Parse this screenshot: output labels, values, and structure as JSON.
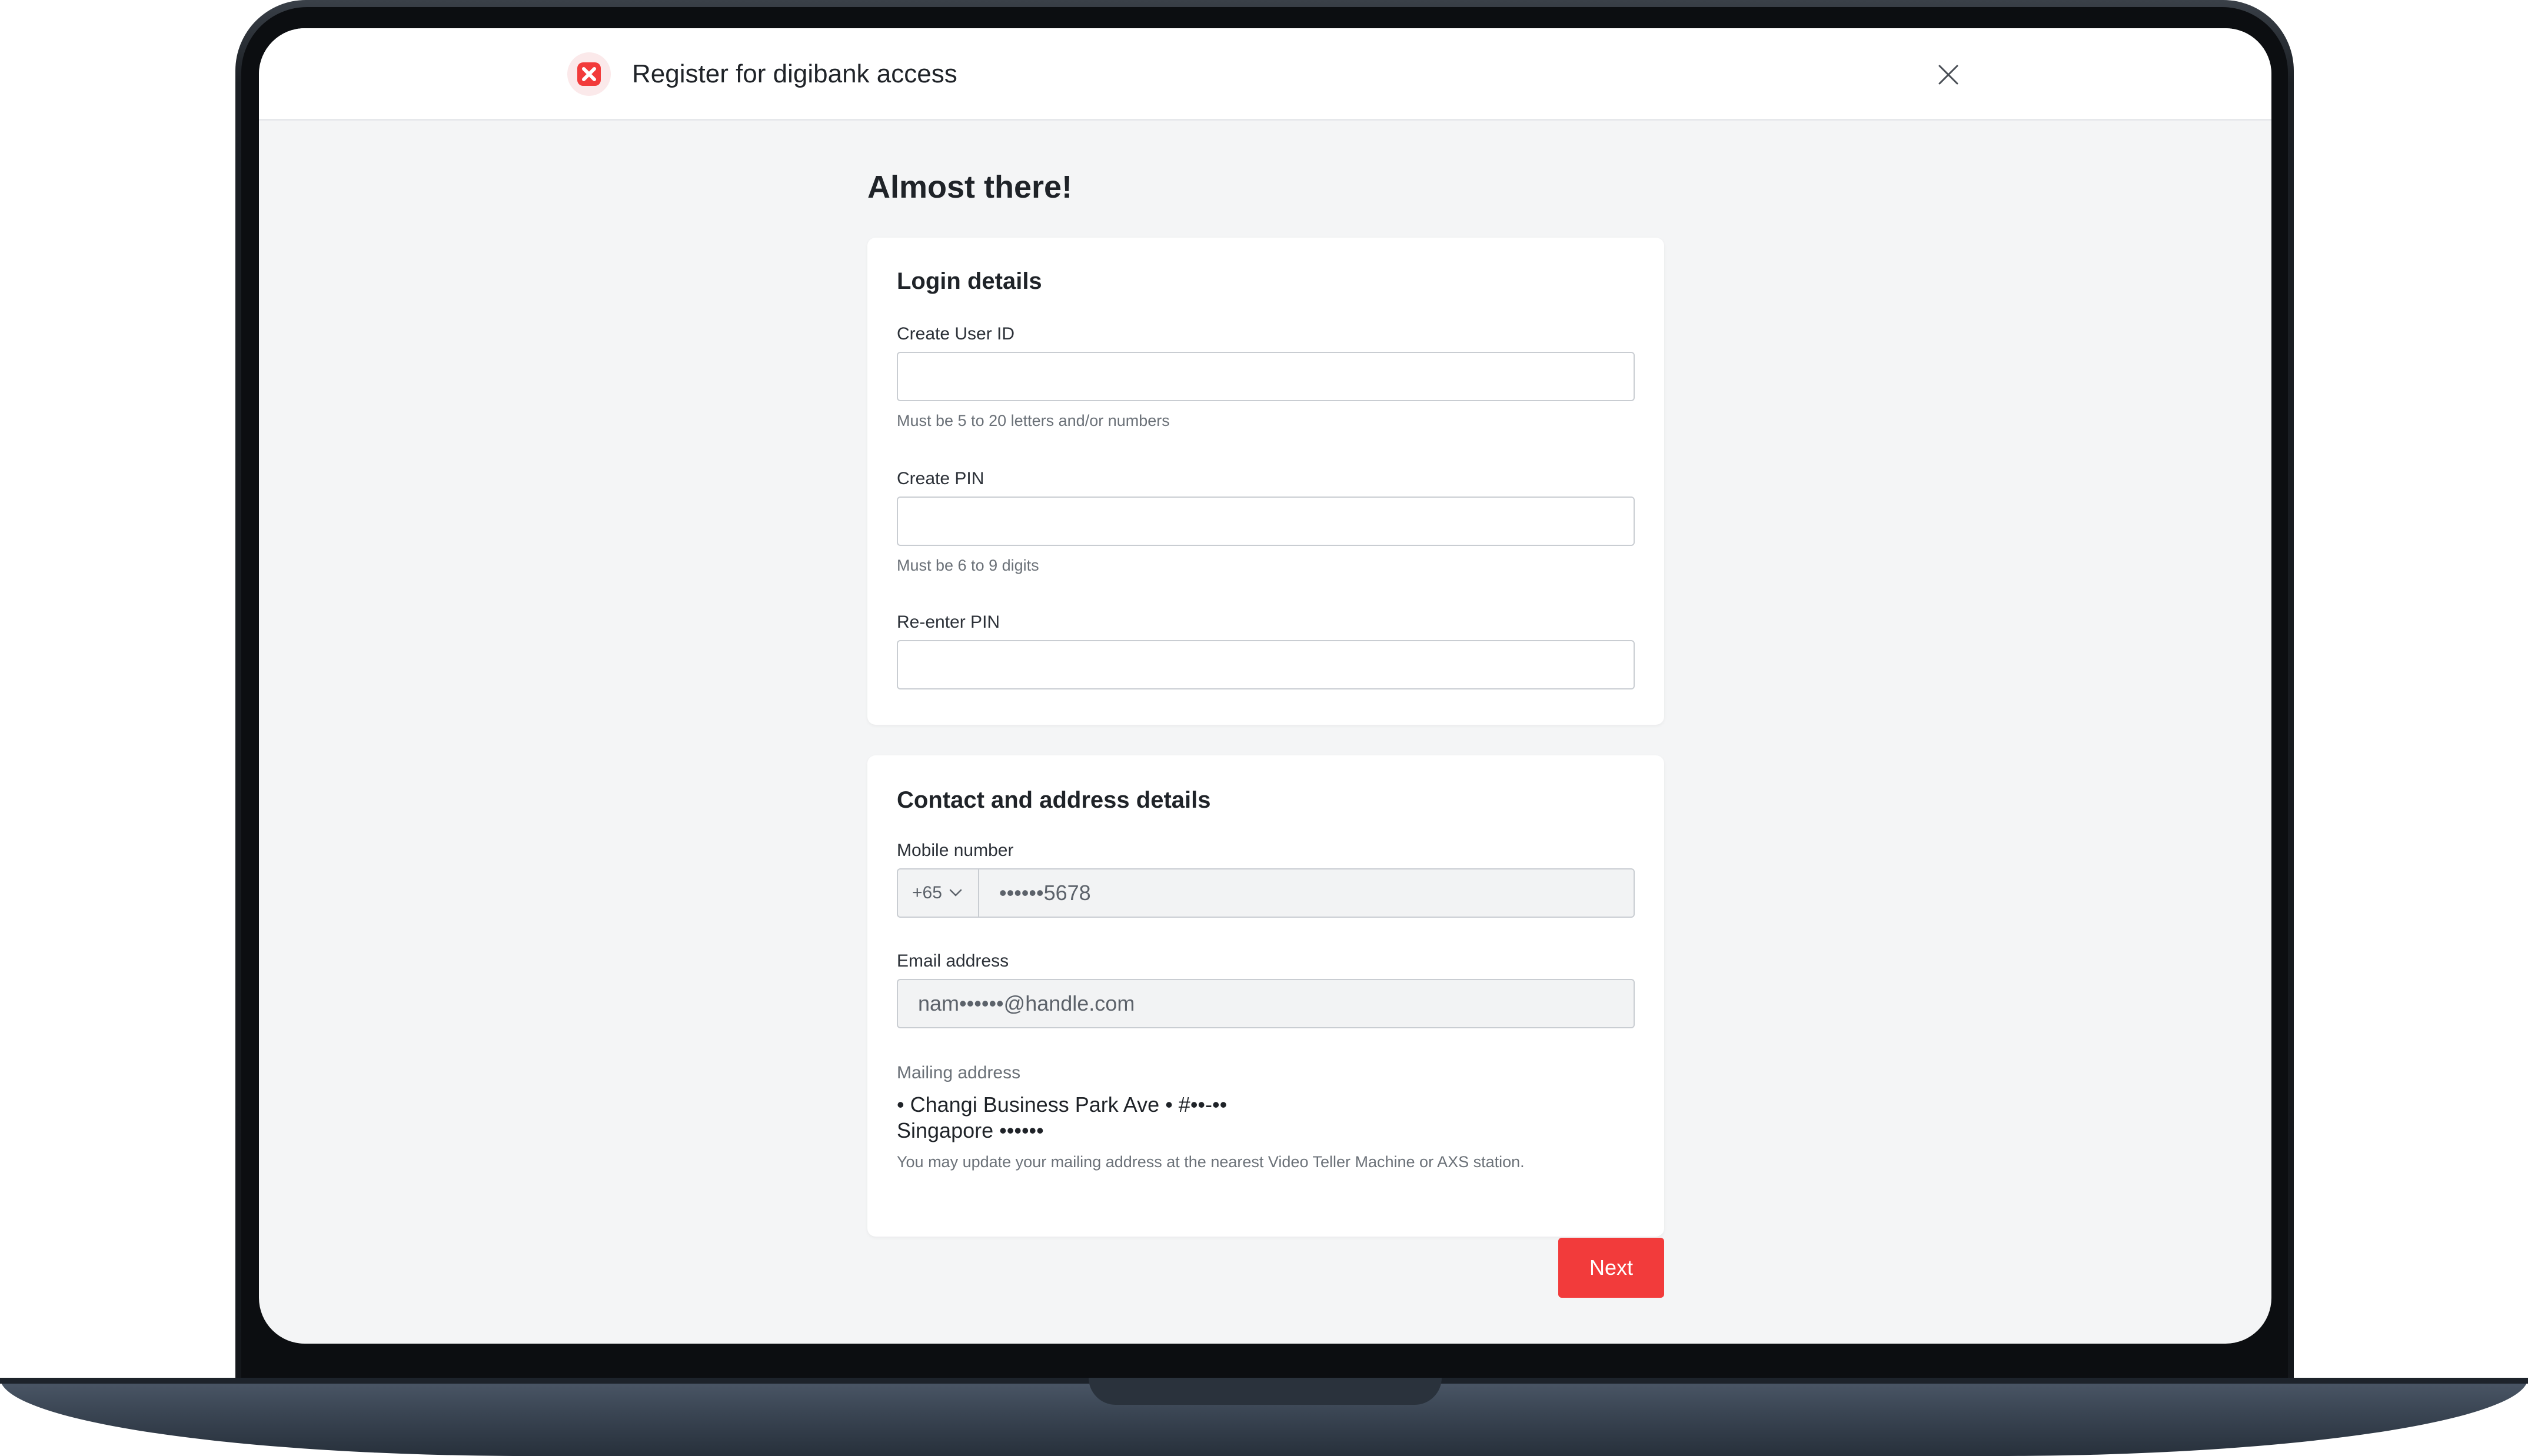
{
  "header": {
    "title": "Register for digibank access",
    "logo_icon": "dbs-logo-icon",
    "close_icon": "close-icon"
  },
  "page": {
    "heading": "Almost there!"
  },
  "login_details": {
    "title": "Login details",
    "user_id": {
      "label": "Create User ID",
      "value": "",
      "hint": "Must be 5 to 20 letters and/or numbers"
    },
    "pin": {
      "label": "Create PIN",
      "value": "",
      "hint": "Must be 6 to 9 digits"
    },
    "reenter_pin": {
      "label": "Re-enter PIN",
      "value": ""
    }
  },
  "contact_details": {
    "title": "Contact and address details",
    "mobile": {
      "label": "Mobile number",
      "country_code": "+65",
      "value": "••••••5678"
    },
    "email": {
      "label": "Email address",
      "value": "nam••••••@handle.com"
    },
    "mailing": {
      "label": "Mailing address",
      "line1": "• Changi Business Park Ave • #••-••",
      "line2": "Singapore ••••••",
      "note": "You may update your mailing address at the nearest Video Teller Machine or AXS station."
    }
  },
  "actions": {
    "next_label": "Next"
  },
  "colors": {
    "brand_red": "#f23b3b",
    "background": "#f4f5f6"
  }
}
